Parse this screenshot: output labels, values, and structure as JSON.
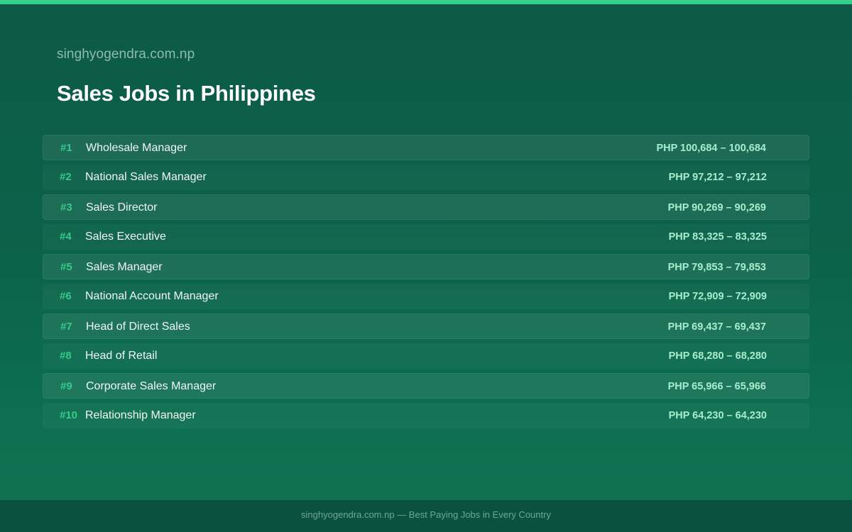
{
  "site": "singhyogendra.com.np",
  "title": "Sales Jobs in Philippines",
  "colors": {
    "accent": "#34d08c",
    "rank": "#36c98a",
    "salary": "#a8ecce"
  },
  "jobs": [
    {
      "rank": "#1",
      "title": "Wholesale Manager",
      "salary": "PHP 100,684 – 100,684"
    },
    {
      "rank": "#2",
      "title": "National Sales Manager",
      "salary": "PHP 97,212 – 97,212"
    },
    {
      "rank": "#3",
      "title": "Sales Director",
      "salary": "PHP 90,269 – 90,269"
    },
    {
      "rank": "#4",
      "title": "Sales Executive",
      "salary": "PHP 83,325 – 83,325"
    },
    {
      "rank": "#5",
      "title": "Sales Manager",
      "salary": "PHP 79,853 – 79,853"
    },
    {
      "rank": "#6",
      "title": "National Account Manager",
      "salary": "PHP 72,909 – 72,909"
    },
    {
      "rank": "#7",
      "title": "Head of Direct Sales",
      "salary": "PHP 69,437 – 69,437"
    },
    {
      "rank": "#8",
      "title": "Head of Retail",
      "salary": "PHP 68,280 – 68,280"
    },
    {
      "rank": "#9",
      "title": "Corporate Sales Manager",
      "salary": "PHP 65,966 – 65,966"
    },
    {
      "rank": "#10",
      "title": "Relationship Manager",
      "salary": "PHP 64,230 – 64,230"
    }
  ],
  "footer": "singhyogendra.com.np — Best Paying Jobs in Every Country"
}
